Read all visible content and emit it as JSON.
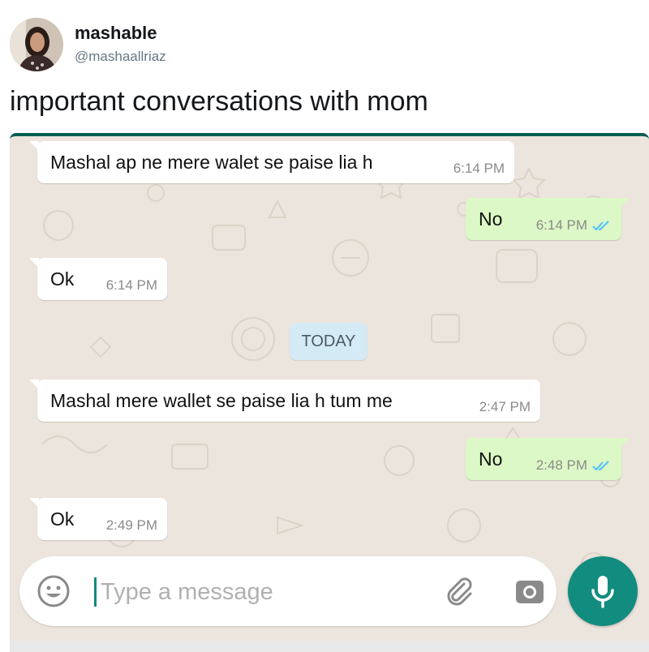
{
  "tweet": {
    "display_name": "mashable",
    "handle": "@mashaallriaz",
    "text": "important conversations with mom"
  },
  "chat": {
    "messages": [
      {
        "text": "Mashal ap ne mere walet se paise lia h",
        "time": "6:14 PM",
        "direction": "incoming"
      },
      {
        "text": "No",
        "time": "6:14 PM",
        "direction": "outgoing",
        "status": "read"
      },
      {
        "text": "Ok",
        "time": "6:14 PM",
        "direction": "incoming"
      },
      {
        "text": "Mashal mere wallet se paise lia h tum me",
        "time": "2:47 PM",
        "direction": "incoming"
      },
      {
        "text": "No",
        "time": "2:48 PM",
        "direction": "outgoing",
        "status": "read"
      },
      {
        "text": "Ok",
        "time": "2:49 PM",
        "direction": "incoming"
      }
    ],
    "date_divider": "TODAY"
  },
  "composer": {
    "placeholder": "Type a message",
    "value": "",
    "emoji_icon": "smiley-icon",
    "attach_icon": "paperclip-icon",
    "camera_icon": "camera-icon",
    "mic_icon": "microphone-icon"
  },
  "colors": {
    "header_teal": "#075e54",
    "accent_teal": "#128c7e",
    "outgoing_bubble": "#dcf8c6",
    "chat_background": "#ece5dd",
    "read_ticks": "#4fc3f7",
    "date_chip": "#d4eaf4"
  }
}
